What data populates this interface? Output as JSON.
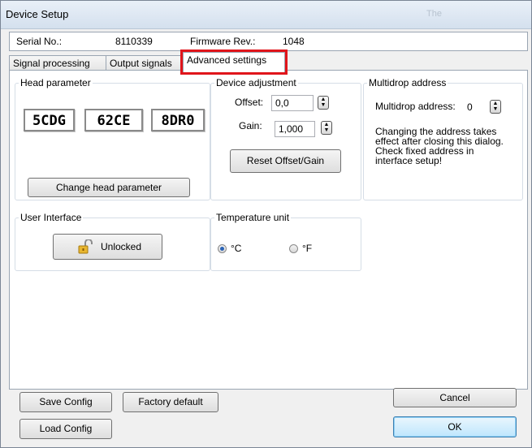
{
  "window": {
    "title": "Device Setup",
    "ghost_text": "The"
  },
  "info": {
    "serial_label": "Serial No.:",
    "serial_value": "8110339",
    "firmware_label": "Firmware Rev.:",
    "firmware_value": "1048"
  },
  "tabs": [
    {
      "label": "Signal processing"
    },
    {
      "label": "Output signals"
    },
    {
      "label": "Advanced settings"
    }
  ],
  "head_parameter": {
    "legend": "Head parameter",
    "codes": [
      "5CDG",
      "62CE",
      "8DR0"
    ],
    "button": "Change head parameter"
  },
  "device_adjustment": {
    "legend": "Device adjustment",
    "offset_label": "Offset:",
    "offset_value": "0,0",
    "gain_label": "Gain:",
    "gain_value": "1,000",
    "reset_button": "Reset Offset/Gain"
  },
  "multidrop": {
    "legend": "Multidrop address",
    "label": "Multidrop address:",
    "value": "0",
    "note_lines": [
      "Changing the address takes",
      "effect after closing this dialog.",
      "Check fixed address in",
      "interface setup!"
    ]
  },
  "user_interface": {
    "legend": "User Interface",
    "button": "Unlocked",
    "icon": "padlock-icon"
  },
  "temperature": {
    "legend": "Temperature unit",
    "option_c": "°C",
    "option_f": "°F",
    "selected": "°C"
  },
  "footer": {
    "save": "Save Config",
    "factory": "Factory default",
    "load": "Load Config",
    "cancel": "Cancel",
    "ok": "OK"
  },
  "colors": {
    "highlight": "#e0151b",
    "ok_border": "#3c7fb1"
  }
}
